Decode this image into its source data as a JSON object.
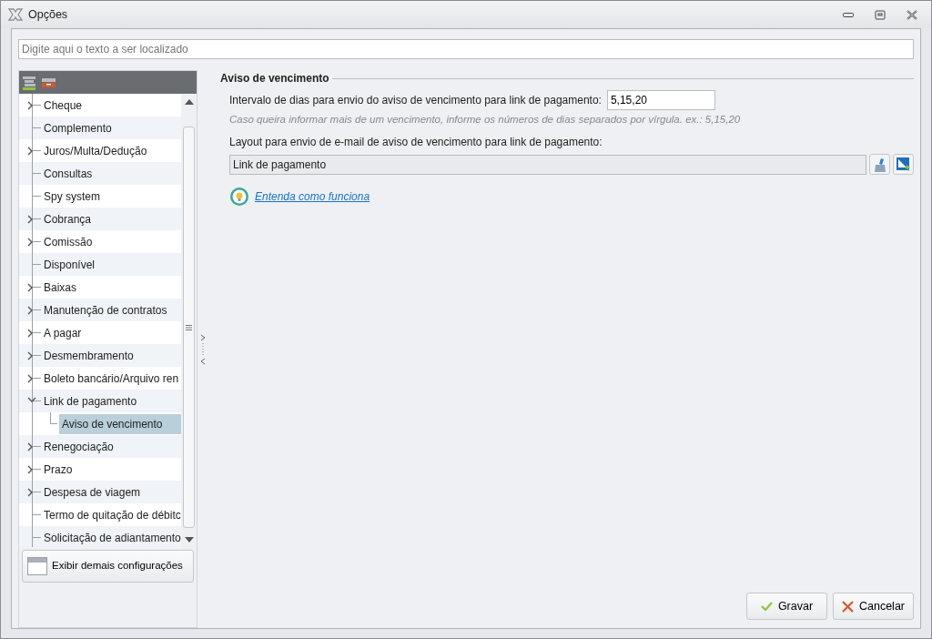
{
  "window": {
    "title": "Opções"
  },
  "search": {
    "placeholder": "Digite aqui o texto a ser localizado"
  },
  "tree": [
    {
      "label": "Cheque",
      "kind": "group",
      "expanded": false,
      "selected": false
    },
    {
      "label": "Complemento",
      "kind": "leaf",
      "selected": false
    },
    {
      "label": "Juros/Multa/Dedução",
      "kind": "group",
      "expanded": false,
      "selected": false
    },
    {
      "label": "Consultas",
      "kind": "leaf",
      "selected": false
    },
    {
      "label": "Spy system",
      "kind": "leaf",
      "selected": false
    },
    {
      "label": "Cobrança",
      "kind": "group",
      "expanded": false,
      "selected": false
    },
    {
      "label": "Comissão",
      "kind": "group",
      "expanded": false,
      "selected": false
    },
    {
      "label": "Disponível",
      "kind": "leaf",
      "selected": false
    },
    {
      "label": "Baixas",
      "kind": "group",
      "expanded": false,
      "selected": false
    },
    {
      "label": "Manutenção de contratos",
      "kind": "group",
      "expanded": false,
      "selected": false
    },
    {
      "label": "A pagar",
      "kind": "group",
      "expanded": false,
      "selected": false
    },
    {
      "label": "Desmembramento",
      "kind": "group",
      "expanded": false,
      "selected": false
    },
    {
      "label": "Boleto bancário/Arquivo ren",
      "kind": "group",
      "expanded": false,
      "selected": false
    },
    {
      "label": "Link de pagamento",
      "kind": "group",
      "expanded": true,
      "selected": false,
      "children": [
        {
          "label": "Aviso de vencimento",
          "selected": true
        }
      ]
    },
    {
      "label": "Renegociação",
      "kind": "group",
      "expanded": false,
      "selected": false
    },
    {
      "label": "Prazo",
      "kind": "group",
      "expanded": false,
      "selected": false
    },
    {
      "label": "Despesa de viagem",
      "kind": "group",
      "expanded": false,
      "selected": false
    },
    {
      "label": "Termo de quitação de débitc",
      "kind": "leaf",
      "selected": false
    },
    {
      "label": "Solicitação de adiantamento",
      "kind": "leaf",
      "selected": false
    }
  ],
  "more_button": "Exibir demais configurações",
  "section": {
    "title": "Aviso de vencimento",
    "interval_label": "Intervalo de dias para envio do aviso de vencimento para link de pagamento:",
    "interval_value": "5,15,20",
    "hint": "Caso queira informar mais de um vencimento, informe os números de dias separados por vírgula. ex.: 5,15,20",
    "layout_label": "Layout para envio de e-mail de aviso de vencimento para link de pagamento:",
    "layout_value": "Link de pagamento",
    "help_link": "Entenda como funciona"
  },
  "buttons": [
    {
      "kind": "save",
      "label": "Gravar"
    },
    {
      "kind": "cancel",
      "label": "Cancelar"
    }
  ]
}
